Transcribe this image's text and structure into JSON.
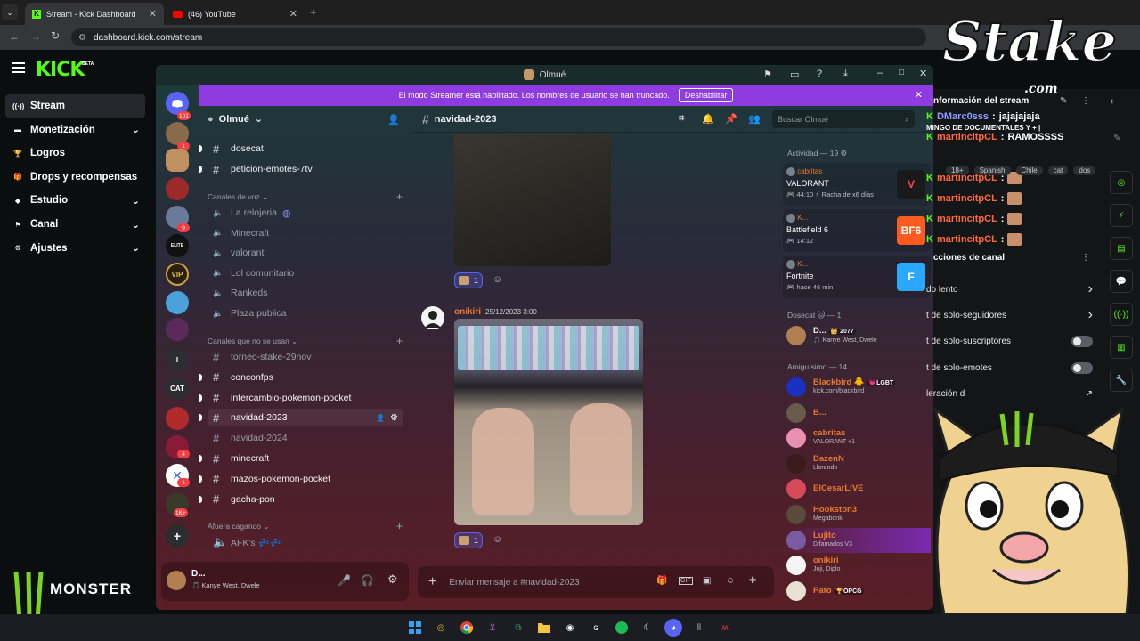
{
  "browser": {
    "tabs": [
      {
        "title": "Stream - Kick Dashboard"
      },
      {
        "title": "(46) YouTube"
      }
    ],
    "url": "dashboard.kick.com/stream"
  },
  "kick": {
    "logo": "KICK",
    "beta": "BETA",
    "nav": [
      {
        "label": "Stream",
        "icon": "broadcast-icon",
        "active": true
      },
      {
        "label": "Monetización",
        "icon": "money-icon"
      },
      {
        "label": "Logros",
        "icon": "trophy-icon"
      },
      {
        "label": "Drops y recompensas",
        "icon": "gift-icon"
      },
      {
        "label": "Estudio",
        "icon": "studio-icon"
      },
      {
        "label": "Canal",
        "icon": "flag-icon"
      },
      {
        "label": "Ajustes",
        "icon": "gear-icon"
      }
    ],
    "monster_text": "MONSTER"
  },
  "discord": {
    "window_title": "Olmué",
    "banner": {
      "text": "El modo Streamer está habilitado. Los nombres de usuario se han truncado.",
      "button": "Deshabilitar"
    },
    "server_name": "Olmué",
    "server_badges": {
      "top": "101",
      "s1": "1",
      "s2": "9",
      "s3": "4",
      "s4": "1",
      "s5": "1K+"
    },
    "server_labels": {
      "i": "I",
      "cat": "CAT",
      "elite": "ELITE",
      "vip": "VIP"
    },
    "channels_top": [
      {
        "name": "dosecat"
      },
      {
        "name": "peticion-emotes-7tv"
      }
    ],
    "voice_category": "Canales de voz",
    "voice_channels": [
      {
        "name": "La relojeria"
      },
      {
        "name": "Minecraft"
      },
      {
        "name": "valorant"
      },
      {
        "name": "Lol comunitario"
      },
      {
        "name": "Rankeds"
      },
      {
        "name": "Plaza publica"
      }
    ],
    "unused_category": "Canales que no se usan",
    "unused_channels": [
      {
        "name": "torneo-stake-29nov"
      },
      {
        "name": "conconfps"
      },
      {
        "name": "intercambio-pokemon-pocket"
      },
      {
        "name": "navidad-2023"
      },
      {
        "name": "navidad-2024"
      },
      {
        "name": "minecraft"
      },
      {
        "name": "mazos-pokemon-pocket"
      },
      {
        "name": "gacha-pon"
      }
    ],
    "afuera_category": "Afuera cagando",
    "afk_channel": "AFK's 💤💤",
    "user_panel": {
      "name": "D...",
      "status": "🎵 Kanye West, Dwele"
    },
    "chat": {
      "channel": "navidad-2023",
      "search_placeholder": "Buscar Olmué",
      "message_author": "onikiri",
      "message_time": "25/12/2023 3:00",
      "reaction_count_1": "1",
      "reaction_count_2": "1",
      "composer_placeholder": "Enviar mensaje a #navidad-2023",
      "composer_gif": "GIF"
    },
    "members": {
      "activity_header": "Actividad — 19",
      "activities": [
        {
          "user": "cabritas",
          "game": "VALORANT",
          "time": "44:10",
          "extra": "Racha de x6 días",
          "icon_text": "V",
          "icon_color": "#ff4655"
        },
        {
          "user": "K...",
          "game": "Battlefield 6",
          "time": "14:12",
          "icon_text": "BF6",
          "icon_color": "#ff5a1f"
        },
        {
          "user": "K...",
          "game": "Fortnite",
          "time": "hace 46 min",
          "icon_text": "F",
          "icon_color": "#2aa7ff"
        }
      ],
      "dosecat_header": "Dosecat 🐱 — 1",
      "dosecat_member": {
        "name": "D...",
        "badge": "👑 2077",
        "status": "Kanye West, Dwele"
      },
      "amiguisimo_header": "Amiguísimo — 14",
      "list": [
        {
          "name": "Blackbird 🐥",
          "tag": "💗LGBT",
          "status": "kick.com/blackbird",
          "color": "#e8792f"
        },
        {
          "name": "B...",
          "status": "",
          "color": "#e8792f"
        },
        {
          "name": "cabritas",
          "status": "VALORANT +1",
          "color": "#e8792f"
        },
        {
          "name": "DazenN",
          "status": "Llorando",
          "color": "#e8792f"
        },
        {
          "name": "ElCesarLIVE",
          "status": "",
          "color": "#e8792f"
        },
        {
          "name": "Hookston3",
          "status": "Megabonk",
          "color": "#e8792f"
        },
        {
          "name": "Lujito",
          "status": "Difamados V3",
          "color": "#e8792f"
        },
        {
          "name": "onikiri",
          "status": "Joji, Diplo",
          "color": "#e8792f"
        },
        {
          "name": "Pato",
          "tag": "🏆OPCG",
          "status": "",
          "color": "#e8792f"
        }
      ]
    }
  },
  "overlay": {
    "stake_logo": "Stake",
    "stake_com": ".com",
    "stream_info_title": "nformación del stream",
    "chat": [
      {
        "user": "DMarc0sss",
        "text": "jajajajaja"
      },
      {
        "user": "",
        "text": "MINGO DE DOCUMENTALES Y + |"
      },
      {
        "user": "martincitpCL",
        "text": "RAMOSSSS"
      },
      {
        "user": "martincitpCL",
        "text": ""
      },
      {
        "user": "martincitpCL",
        "text": ""
      },
      {
        "user": "martincitpCL",
        "text": ""
      },
      {
        "user": "martincitpCL",
        "text": ""
      }
    ],
    "tags": [
      "18+",
      "Spanish",
      "Chile",
      "cat",
      "dos"
    ],
    "channel_actions": "cciones de canal",
    "settings": [
      {
        "label": "do lento",
        "control": "chevron"
      },
      {
        "label": "t de solo-seguidores",
        "control": "chevron"
      },
      {
        "label": "t de solo-suscriptores",
        "control": "toggle"
      },
      {
        "label": "t de solo-emotes",
        "control": "toggle"
      },
      {
        "label": "leración d",
        "control": "link"
      }
    ]
  },
  "colors": {
    "kick_green": "#53fc18",
    "discord_blurple": "#5865f2",
    "streamer_banner": "#8e3be0",
    "notification_red": "#f23f43"
  }
}
